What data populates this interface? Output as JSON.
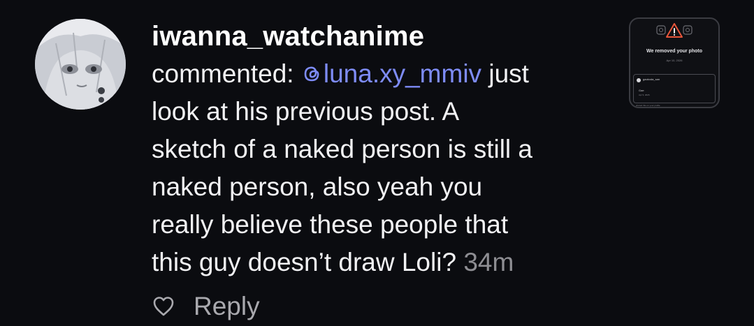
{
  "comment": {
    "username": "iwanna_watchanime",
    "prefix": "commented: ",
    "mention": "luna.xy_mmiv",
    "lines": [
      " just",
      "look at his previous post. A",
      "sketch of a naked person is still a",
      "naked person, also yeah you",
      "really believe these people that",
      "this guy doesn’t draw Loli?"
    ],
    "timestamp": "34m"
  },
  "actions": {
    "reply_label": "Reply"
  },
  "thumbnail": {
    "title": "We removed your photo",
    "date": "Apr 10, 2026",
    "card_user": "gaokoda_san",
    "card_text": "Gae",
    "card_date": "Apr 9, 2026",
    "footer": "shared this on your profile"
  },
  "colors": {
    "background": "#0b0c10",
    "text": "#f2f2f4",
    "mention": "#7e8cf7",
    "muted": "#8e8e93",
    "warning": "#e8553a"
  },
  "icons": {
    "mention": "threads-at-icon",
    "like": "heart-outline-icon",
    "notice": "warning-triangle-icon"
  }
}
